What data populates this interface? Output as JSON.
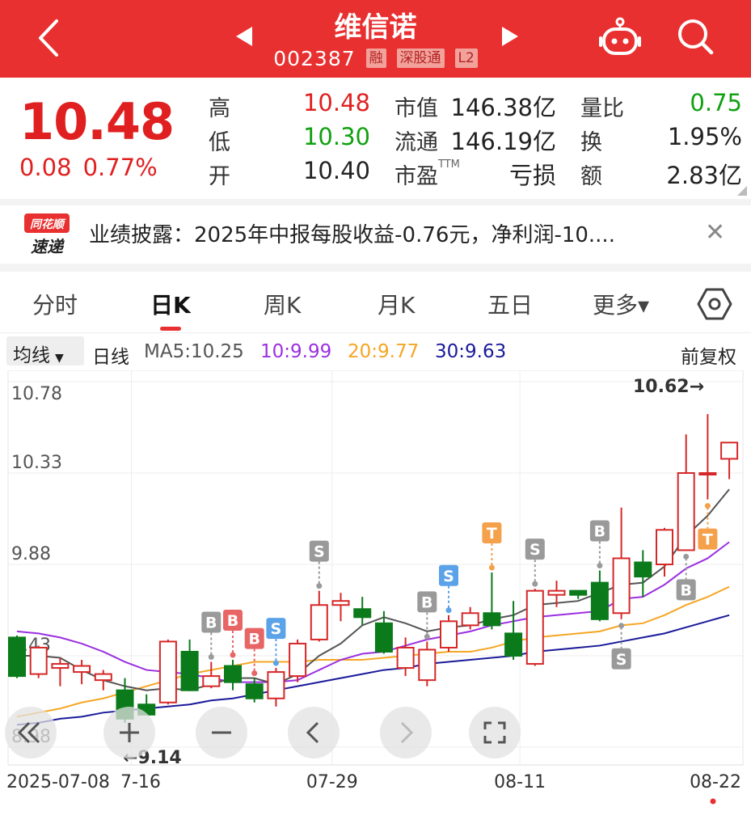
{
  "header": {
    "title": "维信诺",
    "code": "002387",
    "tags": [
      "融",
      "深股通",
      "L2"
    ]
  },
  "quote": {
    "price": "10.48",
    "change": "0.08",
    "change_pct": "0.77%",
    "fields": {
      "high_label": "高",
      "high": "10.48",
      "low_label": "低",
      "low": "10.30",
      "open_label": "开",
      "open": "10.40",
      "mcap_label": "市值",
      "mcap": "146.38亿",
      "float_label": "流通",
      "float": "146.19亿",
      "pe_label": "市盈",
      "pe_sup": "TTM",
      "pe": "亏损",
      "vol_ratio_label": "量比",
      "vol_ratio": "0.75",
      "turnover_label": "换",
      "turnover": "1.95%",
      "amount_label": "额",
      "amount": "2.83亿"
    }
  },
  "news": {
    "logo_top": "同花顺",
    "logo_bottom": "速递",
    "text": "业绩披露：2025年中报每股收益-0.76元，净利润-10...."
  },
  "tabs": [
    "分时",
    "日K",
    "周K",
    "月K",
    "五日",
    "更多▾"
  ],
  "active_tab": "日K",
  "ma_bar": {
    "select": "均线",
    "period": "日线",
    "ma5": "MA5:10.25",
    "ma10": "10:9.99",
    "ma20": "20:9.77",
    "ma30": "30:9.63",
    "adjust": "前复权"
  },
  "colors": {
    "brand_red": "#e93030",
    "up": "#d62728",
    "down": "#0a7a1a",
    "ma5": "#555555",
    "ma10": "#9b30e0",
    "ma20": "#f5a623",
    "ma30": "#1a1a9a"
  },
  "chart_data": {
    "type": "candlestick",
    "y_ticks": [
      "10.78",
      "10.33",
      "9.88",
      "9.43",
      "8.98"
    ],
    "ylim": [
      8.98,
      10.78
    ],
    "x_labels": [
      "2025-07-08",
      "7-16",
      "07-29",
      "08-11",
      "08-22"
    ],
    "max_label": "10.62→",
    "min_label": "←9.14",
    "candles": [
      [
        9.52,
        9.33,
        9.53,
        9.32
      ],
      [
        9.34,
        9.47,
        9.48,
        9.32
      ],
      [
        9.37,
        9.39,
        9.42,
        9.28
      ],
      [
        9.35,
        9.38,
        9.41,
        9.29
      ],
      [
        9.31,
        9.34,
        9.36,
        9.26
      ],
      [
        9.26,
        9.12,
        9.32,
        9.1
      ],
      [
        9.19,
        9.14,
        9.24,
        9.14
      ],
      [
        9.2,
        9.5,
        9.51,
        9.19
      ],
      [
        9.45,
        9.26,
        9.51,
        9.26
      ],
      [
        9.28,
        9.33,
        9.4,
        9.27
      ],
      [
        9.38,
        9.3,
        9.41,
        9.26
      ],
      [
        9.29,
        9.22,
        9.32,
        9.2
      ],
      [
        9.22,
        9.35,
        9.37,
        9.18
      ],
      [
        9.33,
        9.49,
        9.51,
        9.3
      ],
      [
        9.51,
        9.68,
        9.75,
        9.5
      ],
      [
        9.68,
        9.7,
        9.74,
        9.6
      ],
      [
        9.66,
        9.62,
        9.72,
        9.58
      ],
      [
        9.59,
        9.45,
        9.65,
        9.44
      ],
      [
        9.37,
        9.47,
        9.52,
        9.33
      ],
      [
        9.31,
        9.46,
        9.5,
        9.28
      ],
      [
        9.47,
        9.6,
        9.63,
        9.45
      ],
      [
        9.58,
        9.64,
        9.67,
        9.56
      ],
      [
        9.64,
        9.58,
        9.84,
        9.56
      ],
      [
        9.54,
        9.43,
        9.7,
        9.41
      ],
      [
        9.39,
        9.75,
        9.76,
        9.38
      ],
      [
        9.73,
        9.75,
        9.8,
        9.67
      ],
      [
        9.75,
        9.73,
        9.74,
        9.71
      ],
      [
        9.79,
        9.61,
        9.85,
        9.6
      ],
      [
        9.64,
        9.91,
        10.16,
        9.61
      ],
      [
        9.89,
        9.82,
        9.95,
        9.72
      ],
      [
        9.88,
        10.05,
        10.06,
        9.82
      ],
      [
        9.95,
        10.33,
        10.52,
        9.95
      ],
      [
        10.33,
        10.33,
        10.62,
        10.2
      ],
      [
        10.4,
        10.48,
        10.48,
        10.3
      ]
    ],
    "ma5": [
      9.43,
      9.43,
      9.42,
      9.36,
      9.31,
      9.28,
      9.26,
      9.27,
      9.26,
      9.29,
      9.32,
      9.32,
      9.29,
      9.34,
      9.43,
      9.49,
      9.58,
      9.62,
      9.59,
      9.55,
      9.57,
      9.58,
      9.61,
      9.63,
      9.68,
      9.69,
      9.7,
      9.74,
      9.78,
      9.79,
      9.87,
      10.02,
      10.12,
      10.25
    ],
    "ma10": [
      9.55,
      9.54,
      9.52,
      9.49,
      9.45,
      9.4,
      9.36,
      9.35,
      9.34,
      9.32,
      9.3,
      9.3,
      9.3,
      9.31,
      9.36,
      9.41,
      9.44,
      9.45,
      9.48,
      9.51,
      9.53,
      9.55,
      9.58,
      9.6,
      9.62,
      9.63,
      9.64,
      9.65,
      9.71,
      9.72,
      9.78,
      9.86,
      9.91,
      9.99
    ],
    "ma20": [
      9.13,
      9.15,
      9.17,
      9.2,
      9.22,
      9.25,
      9.28,
      9.31,
      9.34,
      9.36,
      9.38,
      9.4,
      9.4,
      9.4,
      9.41,
      9.41,
      9.41,
      9.42,
      9.43,
      9.44,
      9.45,
      9.45,
      9.47,
      9.5,
      9.52,
      9.53,
      9.54,
      9.55,
      9.58,
      9.59,
      9.63,
      9.68,
      9.72,
      9.77
    ],
    "ma30": [
      9.09,
      9.1,
      9.12,
      9.13,
      9.15,
      9.16,
      9.17,
      9.18,
      9.19,
      9.21,
      9.22,
      9.24,
      9.26,
      9.28,
      9.3,
      9.32,
      9.34,
      9.36,
      9.37,
      9.39,
      9.4,
      9.41,
      9.42,
      9.43,
      9.45,
      9.46,
      9.47,
      9.48,
      9.5,
      9.52,
      9.54,
      9.57,
      9.6,
      9.63
    ],
    "signals": [
      {
        "i": 9,
        "t": "B",
        "color": "#9a9a9a",
        "side": "above"
      },
      {
        "i": 10,
        "t": "B",
        "color": "#e86565",
        "side": "above"
      },
      {
        "i": 11,
        "t": "B",
        "color": "#e86565",
        "side": "above"
      },
      {
        "i": 12,
        "t": "S",
        "color": "#5aa3e8",
        "side": "above"
      },
      {
        "i": 14,
        "t": "S",
        "color": "#9a9a9a",
        "side": "above"
      },
      {
        "i": 19,
        "t": "B",
        "color": "#9a9a9a",
        "side": "above"
      },
      {
        "i": 20,
        "t": "S",
        "color": "#5aa3e8",
        "side": "above"
      },
      {
        "i": 22,
        "t": "T",
        "color": "#f5a04a",
        "side": "above"
      },
      {
        "i": 24,
        "t": "S",
        "color": "#9a9a9a",
        "side": "above"
      },
      {
        "i": 27,
        "t": "B",
        "color": "#9a9a9a",
        "side": "above"
      },
      {
        "i": 28,
        "t": "S",
        "color": "#9a9a9a",
        "side": "below"
      },
      {
        "i": 31,
        "t": "B",
        "color": "#9a9a9a",
        "side": "below"
      },
      {
        "i": 32,
        "t": "T",
        "color": "#f5a04a",
        "side": "below"
      }
    ]
  }
}
